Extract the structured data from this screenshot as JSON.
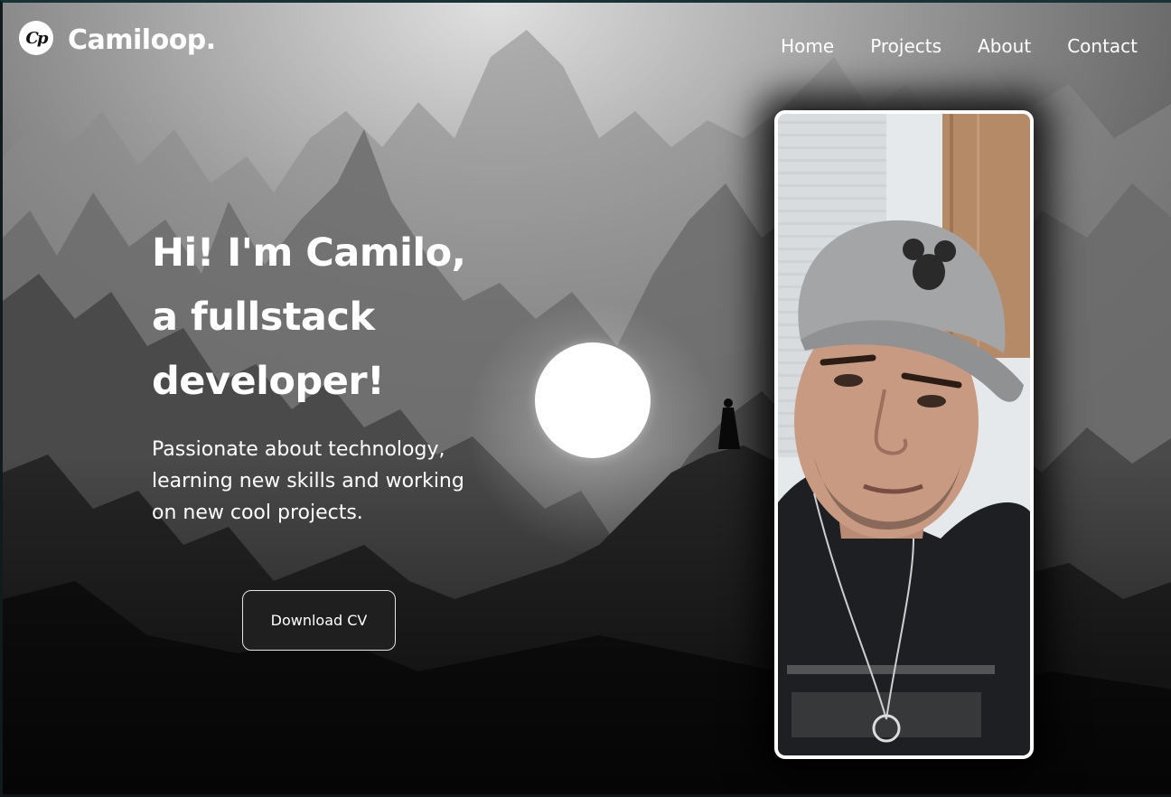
{
  "brand": {
    "logo_initials": "Cp",
    "name": "Camiloop."
  },
  "nav": {
    "items": [
      {
        "label": "Home"
      },
      {
        "label": "Projects"
      },
      {
        "label": "About"
      },
      {
        "label": "Contact"
      }
    ]
  },
  "hero": {
    "headline_lines": [
      "Hi! I'm Camilo,",
      "a fullstack",
      "developer!"
    ],
    "tagline": "Passionate about technology, learning new skills and working on new cool projects.",
    "cta_label": "Download CV"
  },
  "colors": {
    "text": "#ffffff",
    "button_bg": "#1f1f1f",
    "button_border": "#e6e6e6",
    "page_border": "#163338"
  }
}
